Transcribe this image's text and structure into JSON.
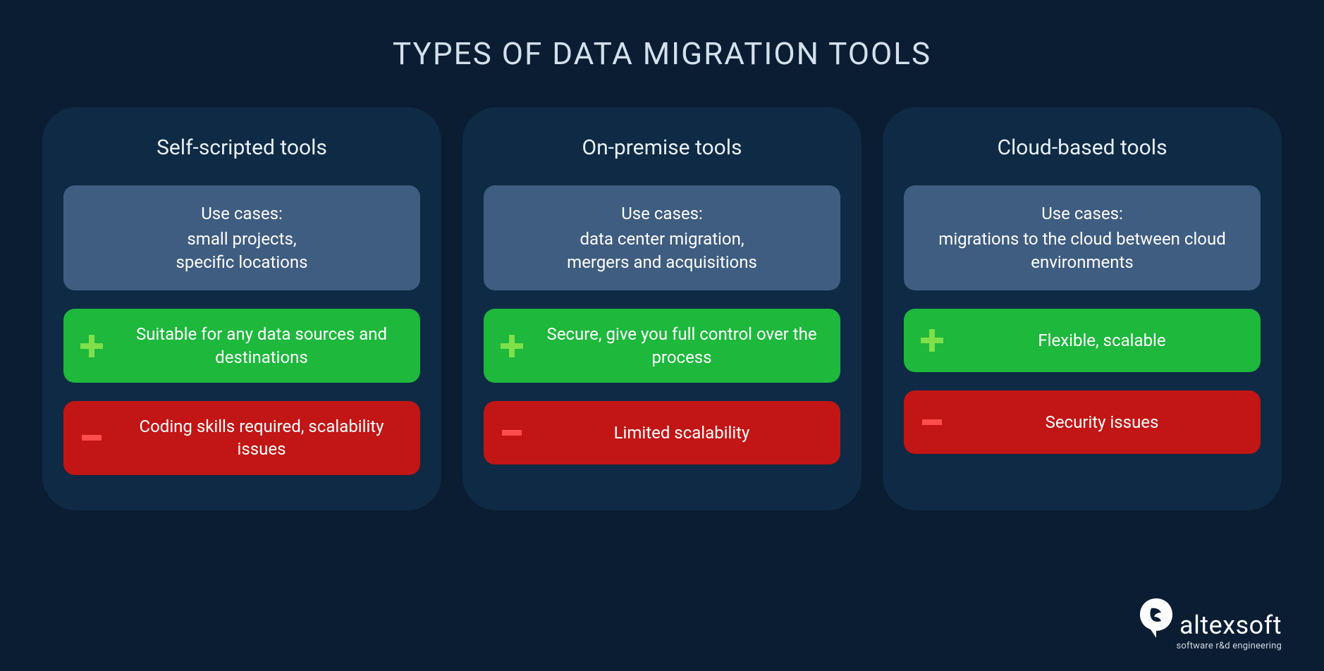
{
  "title": "TYPES OF DATA MIGRATION TOOLS",
  "cards": [
    {
      "title": "Self-scripted tools",
      "usecase_label": "Use cases:",
      "usecase_text": "small projects,\nspecific locations",
      "pro": "Suitable for any data sources and destinations",
      "con": "Coding skills required, scalability issues"
    },
    {
      "title": "On-premise tools",
      "usecase_label": "Use cases:",
      "usecase_text": "data center migration,\nmergers and acquisitions",
      "pro": "Secure, give you full control over the process",
      "con": "Limited scalability"
    },
    {
      "title": "Cloud-based tools",
      "usecase_label": "Use cases:",
      "usecase_text": "migrations to the cloud between cloud environments",
      "pro": "Flexible, scalable",
      "con": "Security issues"
    }
  ],
  "logo": {
    "name": "altexsoft",
    "tagline": "software r&d engineering"
  },
  "colors": {
    "bg": "#0a1d33",
    "card_bg": "#0f2a44",
    "usecase_bg": "#3e5d80",
    "pro_bg": "#1db83c",
    "con_bg": "#c21515"
  }
}
